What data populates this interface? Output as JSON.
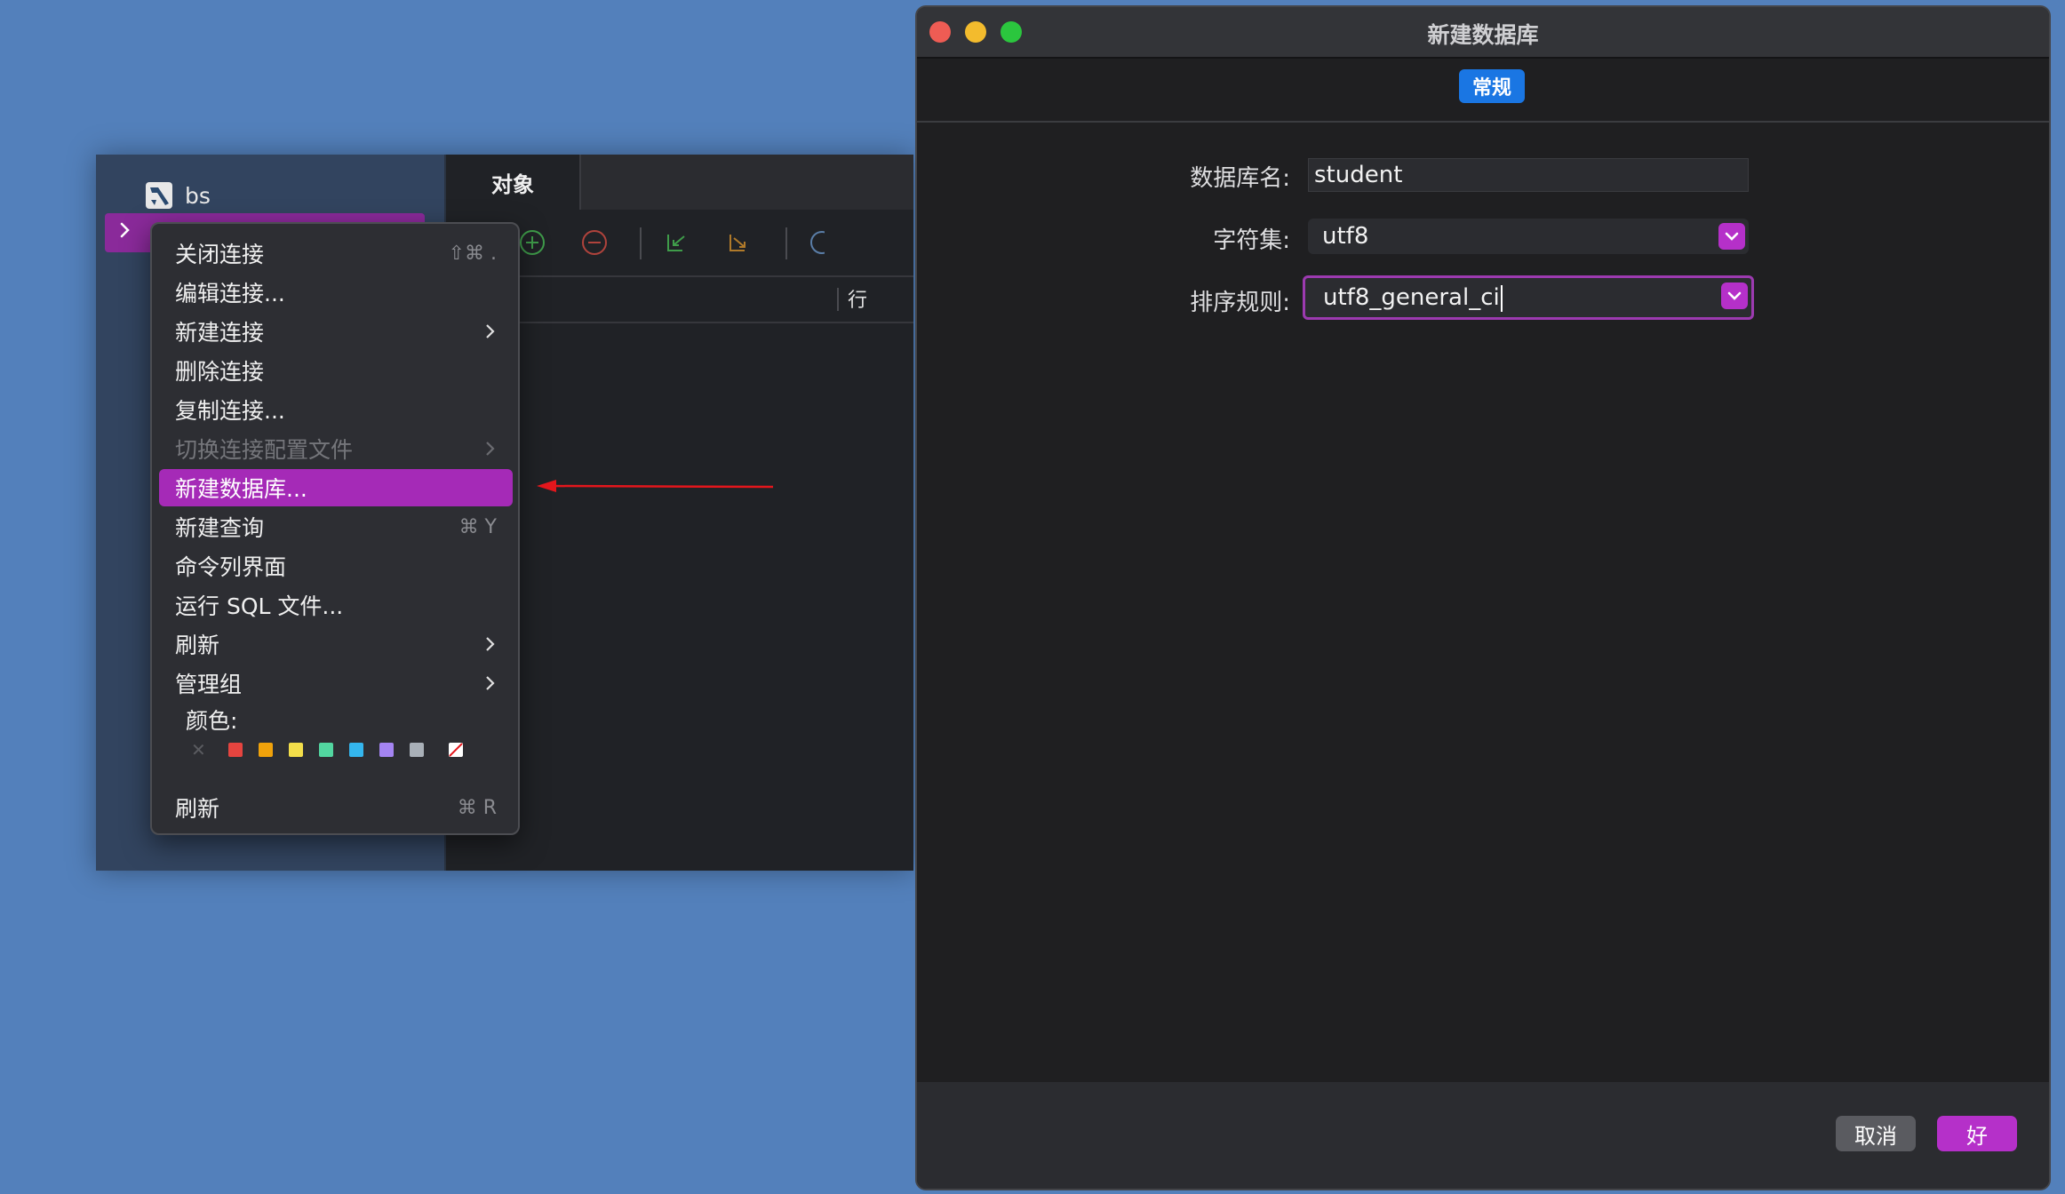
{
  "sidebar": {
    "connection_name": "bs"
  },
  "workarea": {
    "tab_objects": "对象",
    "column_rows": "行"
  },
  "context_menu": {
    "items": [
      {
        "label": "关闭连接",
        "shortcut": "⇧⌘ .",
        "submenu": false,
        "disabled": false
      },
      {
        "label": "编辑连接...",
        "shortcut": "",
        "submenu": false,
        "disabled": false
      },
      {
        "label": "新建连接",
        "shortcut": "",
        "submenu": true,
        "disabled": false
      },
      {
        "label": "删除连接",
        "shortcut": "",
        "submenu": false,
        "disabled": false
      },
      {
        "label": "复制连接...",
        "shortcut": "",
        "submenu": false,
        "disabled": false
      },
      {
        "label": "切换连接配置文件",
        "shortcut": "",
        "submenu": true,
        "disabled": true
      },
      {
        "label": "新建数据库...",
        "shortcut": "",
        "submenu": false,
        "disabled": false,
        "highlighted": true
      },
      {
        "label": "新建查询",
        "shortcut": "⌘ Y",
        "submenu": false,
        "disabled": false
      },
      {
        "label": "命令列界面",
        "shortcut": "",
        "submenu": false,
        "disabled": false
      },
      {
        "label": "运行 SQL 文件...",
        "shortcut": "",
        "submenu": false,
        "disabled": false
      },
      {
        "label": "刷新",
        "shortcut": "",
        "submenu": true,
        "disabled": false
      },
      {
        "label": "管理组",
        "shortcut": "",
        "submenu": true,
        "disabled": false
      }
    ],
    "color_label": "颜色:",
    "colors": [
      "#e5443f",
      "#f0a20b",
      "#f3de4a",
      "#52d6a0",
      "#34b6ee",
      "#a484f2",
      "#a9b0b8"
    ],
    "bottom_item": {
      "label": "刷新",
      "shortcut": "⌘ R"
    }
  },
  "dialog": {
    "title": "新建数据库",
    "tab_general": "常规",
    "db_name_label": "数据库名:",
    "db_name_value": "student",
    "charset_label": "字符集:",
    "charset_value": "utf8",
    "collation_label": "排序规则:",
    "collation_value": "utf8_general_ci",
    "cancel_label": "取消",
    "ok_label": "好"
  },
  "colors": {
    "accent": "#b530c9",
    "highlight": "#a52ab7",
    "tab_blue": "#1a76e3",
    "arrow_red": "#e3161c"
  }
}
